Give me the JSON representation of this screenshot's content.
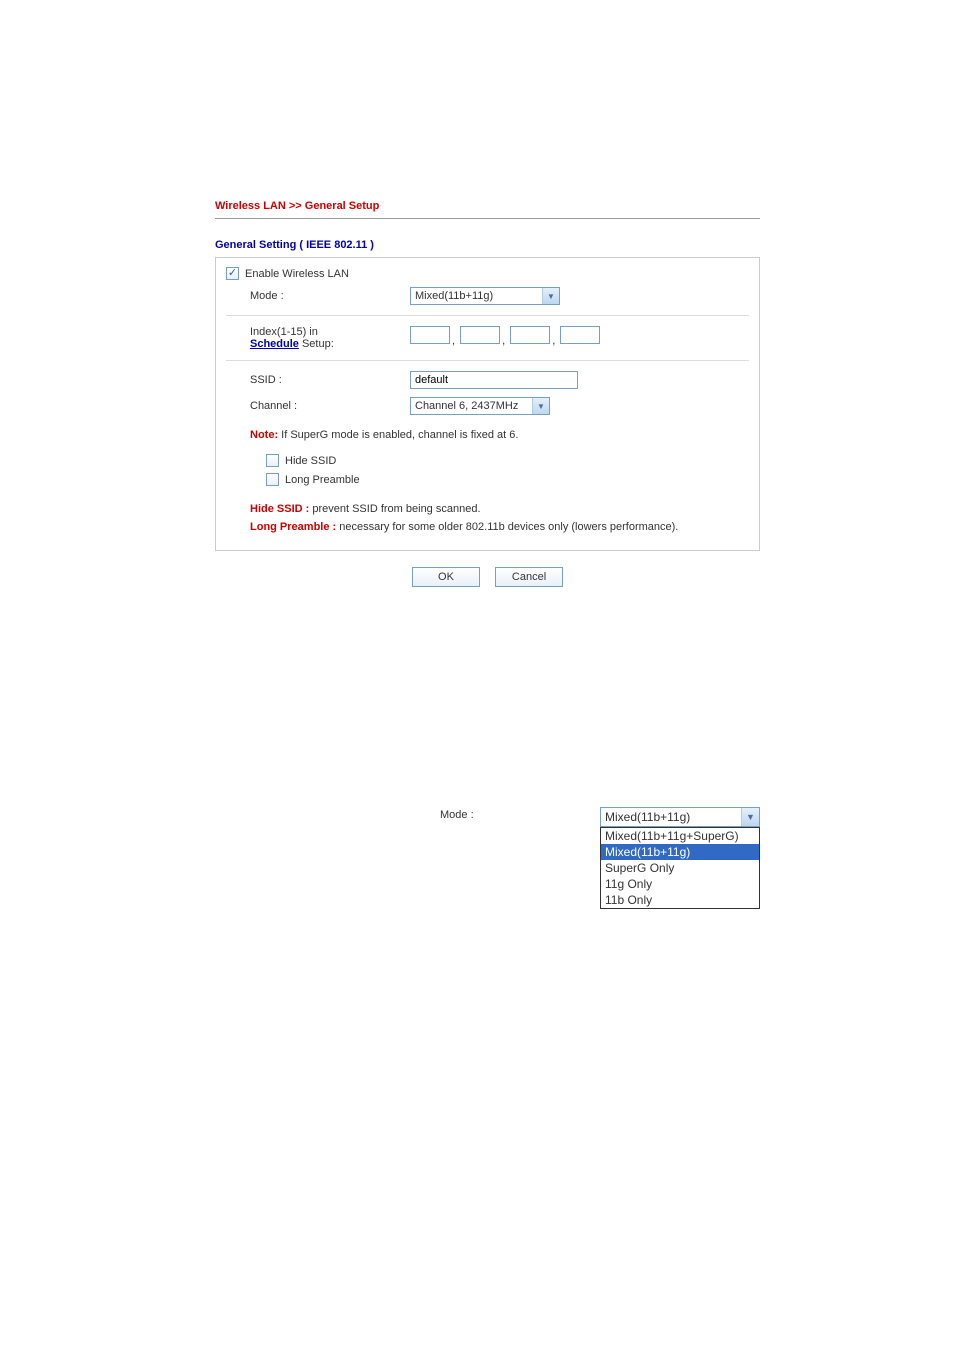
{
  "breadcrumb": "Wireless LAN >> General Setup",
  "section_title": "General Setting ( IEEE 802.11 )",
  "enable_label": "Enable Wireless LAN",
  "mode": {
    "label": "Mode :",
    "value": "Mixed(11b+11g)"
  },
  "schedule": {
    "label_prefix": "Index(1-15) in",
    "link": "Schedule",
    "label_suffix": " Setup:",
    "sep": ","
  },
  "ssid": {
    "label": "SSID :",
    "value": "default"
  },
  "channel": {
    "label": "Channel :",
    "value": "Channel 6, 2437MHz"
  },
  "note": {
    "prefix": "Note:",
    "text": " If SuperG mode is enabled, channel is fixed at 6."
  },
  "hide_ssid_label": "Hide SSID",
  "long_preamble_label": "Long Preamble",
  "desc": {
    "hide_key": "Hide SSID :",
    "hide_text": " prevent SSID from being scanned.",
    "lp_key": "Long Preamble :",
    "lp_text": " necessary for some older 802.11b devices only (lowers performance)."
  },
  "buttons": {
    "ok": "OK",
    "cancel": "Cancel"
  },
  "fig2": {
    "label": "Mode :",
    "selected": "Mixed(11b+11g)",
    "options": [
      "Mixed(11b+11g+SuperG)",
      "Mixed(11b+11g)",
      "SuperG Only",
      "11g Only",
      "11b Only"
    ],
    "highlight_index": 1
  }
}
